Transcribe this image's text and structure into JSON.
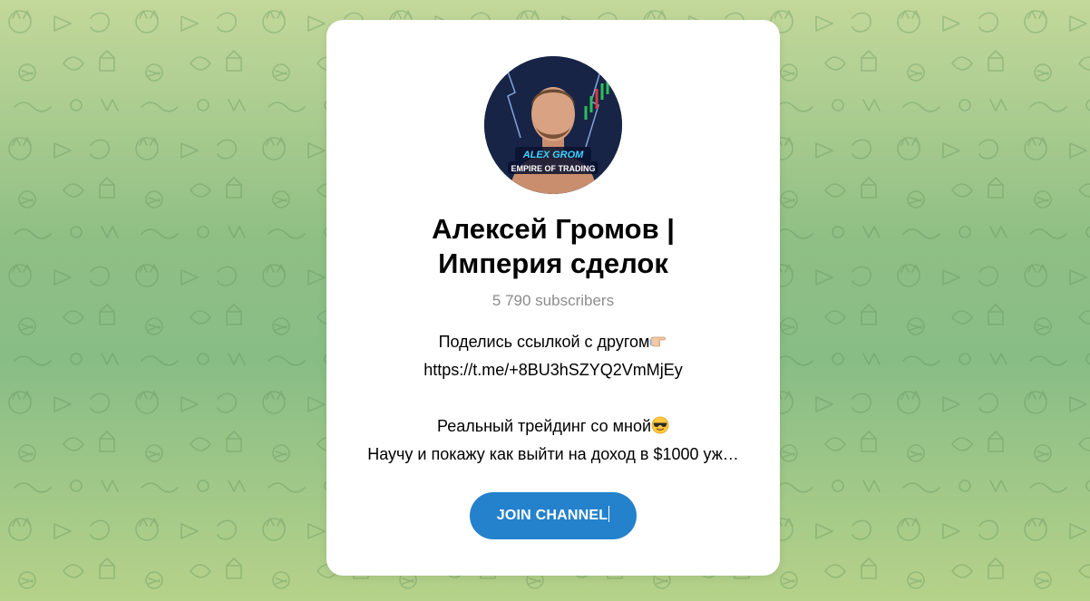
{
  "page": {
    "background_colors": [
      "#c3d89a",
      "#8fbf84",
      "#b6d28a"
    ]
  },
  "card": {
    "avatar": {
      "overlay_line1": "ALEX GROM",
      "overlay_line2": "EMPIRE OF TRADING"
    },
    "title_line1": "Алексей Громов |",
    "title_line2": "Империя сделок",
    "subscribers": "5 790 subscribers",
    "description": {
      "line1": "Поделись ссылкой с другом",
      "line1_emoji": "pointing-hand-icon",
      "line2": "https://t.me/+8BU3hSZYQ2VmMjEy",
      "line3": "Реальный трейдинг со мной",
      "line3_emoji": "sunglasses-face-icon",
      "line4": "Научу и покажу как выйти на доход в $1000 уж…"
    },
    "join_button_label": "JOIN CHANNEL",
    "accent_color": "#2481cc"
  }
}
